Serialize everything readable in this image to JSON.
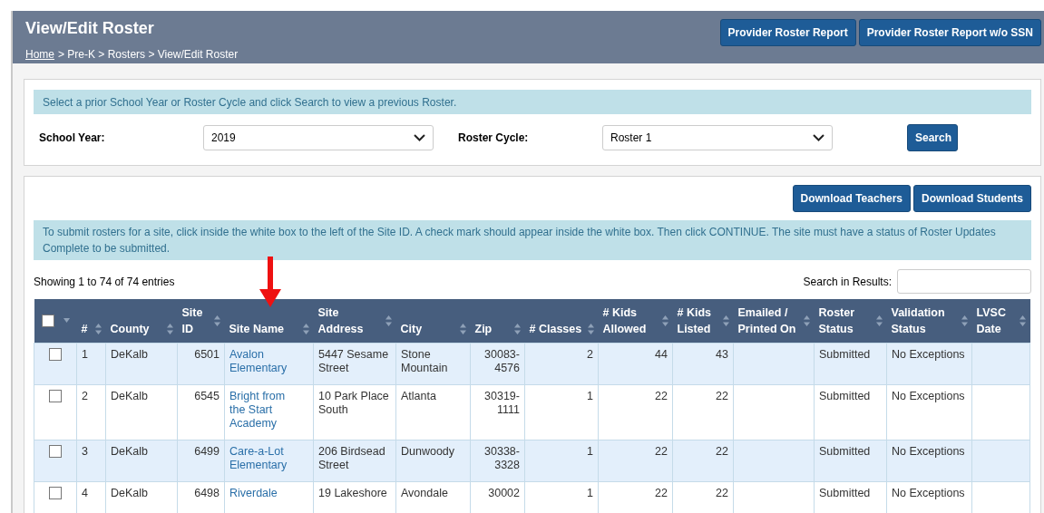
{
  "header": {
    "title": "View/Edit Roster",
    "breadcrumb": [
      {
        "label": "Home",
        "link": true
      },
      {
        "label": "> Pre-K > Rosters > View/Edit Roster",
        "link": false
      }
    ],
    "buttons": [
      "Provider Roster Report",
      "Provider Roster Report w/o SSN"
    ]
  },
  "filter": {
    "info": "Select a prior School Year or Roster Cycle and click Search to view a previous Roster.",
    "school_year": {
      "label": "School Year:",
      "value": "2019"
    },
    "roster_cycle": {
      "label": "Roster Cycle:",
      "value": "Roster 1"
    },
    "search_button": "Search"
  },
  "roster": {
    "buttons": [
      "Download Teachers",
      "Download Students"
    ],
    "info": "To submit rosters for a site, click inside the white box to the left of the Site ID. A check mark should appear inside the white box. Then click CONTINUE. The site must have a status of Roster Updates Complete to be submitted.",
    "showing": "Showing 1 to 74 of 74 entries",
    "search_label": "Search in Results:",
    "select_all": {
      "checked": false
    },
    "columns": [
      {
        "lines": [
          "#"
        ],
        "kind": "text"
      },
      {
        "lines": [
          "County"
        ],
        "kind": "text"
      },
      {
        "lines": [
          "Site",
          "ID"
        ],
        "kind": "number"
      },
      {
        "lines": [
          "Site Name"
        ],
        "kind": "link"
      },
      {
        "lines": [
          "Site",
          "Address"
        ],
        "kind": "text"
      },
      {
        "lines": [
          "City"
        ],
        "kind": "text"
      },
      {
        "lines": [
          "Zip"
        ],
        "kind": "number"
      },
      {
        "lines": [
          "# Classes"
        ],
        "kind": "number"
      },
      {
        "lines": [
          "# Kids",
          "Allowed"
        ],
        "kind": "number"
      },
      {
        "lines": [
          "# Kids",
          "Listed"
        ],
        "kind": "number"
      },
      {
        "lines": [
          "Emailed /",
          "Printed On"
        ],
        "kind": "text"
      },
      {
        "lines": [
          "Roster",
          "Status"
        ],
        "kind": "text"
      },
      {
        "lines": [
          "Validation",
          "Status"
        ],
        "kind": "text"
      },
      {
        "lines": [
          "LVSC",
          "Date"
        ],
        "kind": "text"
      }
    ],
    "rows": [
      {
        "checked": false,
        "cells": [
          "1",
          "DeKalb",
          "6501",
          "Avalon Elementary",
          "5447 Sesame Street",
          "Stone Mountain",
          "30083-4576",
          "2",
          "44",
          "43",
          "",
          "Submitted",
          "No Exceptions",
          ""
        ]
      },
      {
        "checked": false,
        "cells": [
          "2",
          "DeKalb",
          "6545",
          "Bright from the Start Academy",
          "10 Park Place South",
          "Atlanta",
          "30319-1111",
          "1",
          "22",
          "22",
          "",
          "Submitted",
          "No Exceptions",
          ""
        ]
      },
      {
        "checked": false,
        "cells": [
          "3",
          "DeKalb",
          "6499",
          "Care-a-Lot Elementary",
          "206 Birdsead Street",
          "Dunwoody",
          "30338-3328",
          "1",
          "22",
          "22",
          "",
          "Submitted",
          "No Exceptions",
          ""
        ]
      },
      {
        "checked": false,
        "cells": [
          "4",
          "DeKalb",
          "6498",
          "Riverdale",
          "19 Lakeshore",
          "Avondale",
          "30002",
          "1",
          "22",
          "22",
          "",
          "Submitted",
          "No Exceptions",
          ""
        ]
      }
    ]
  }
}
